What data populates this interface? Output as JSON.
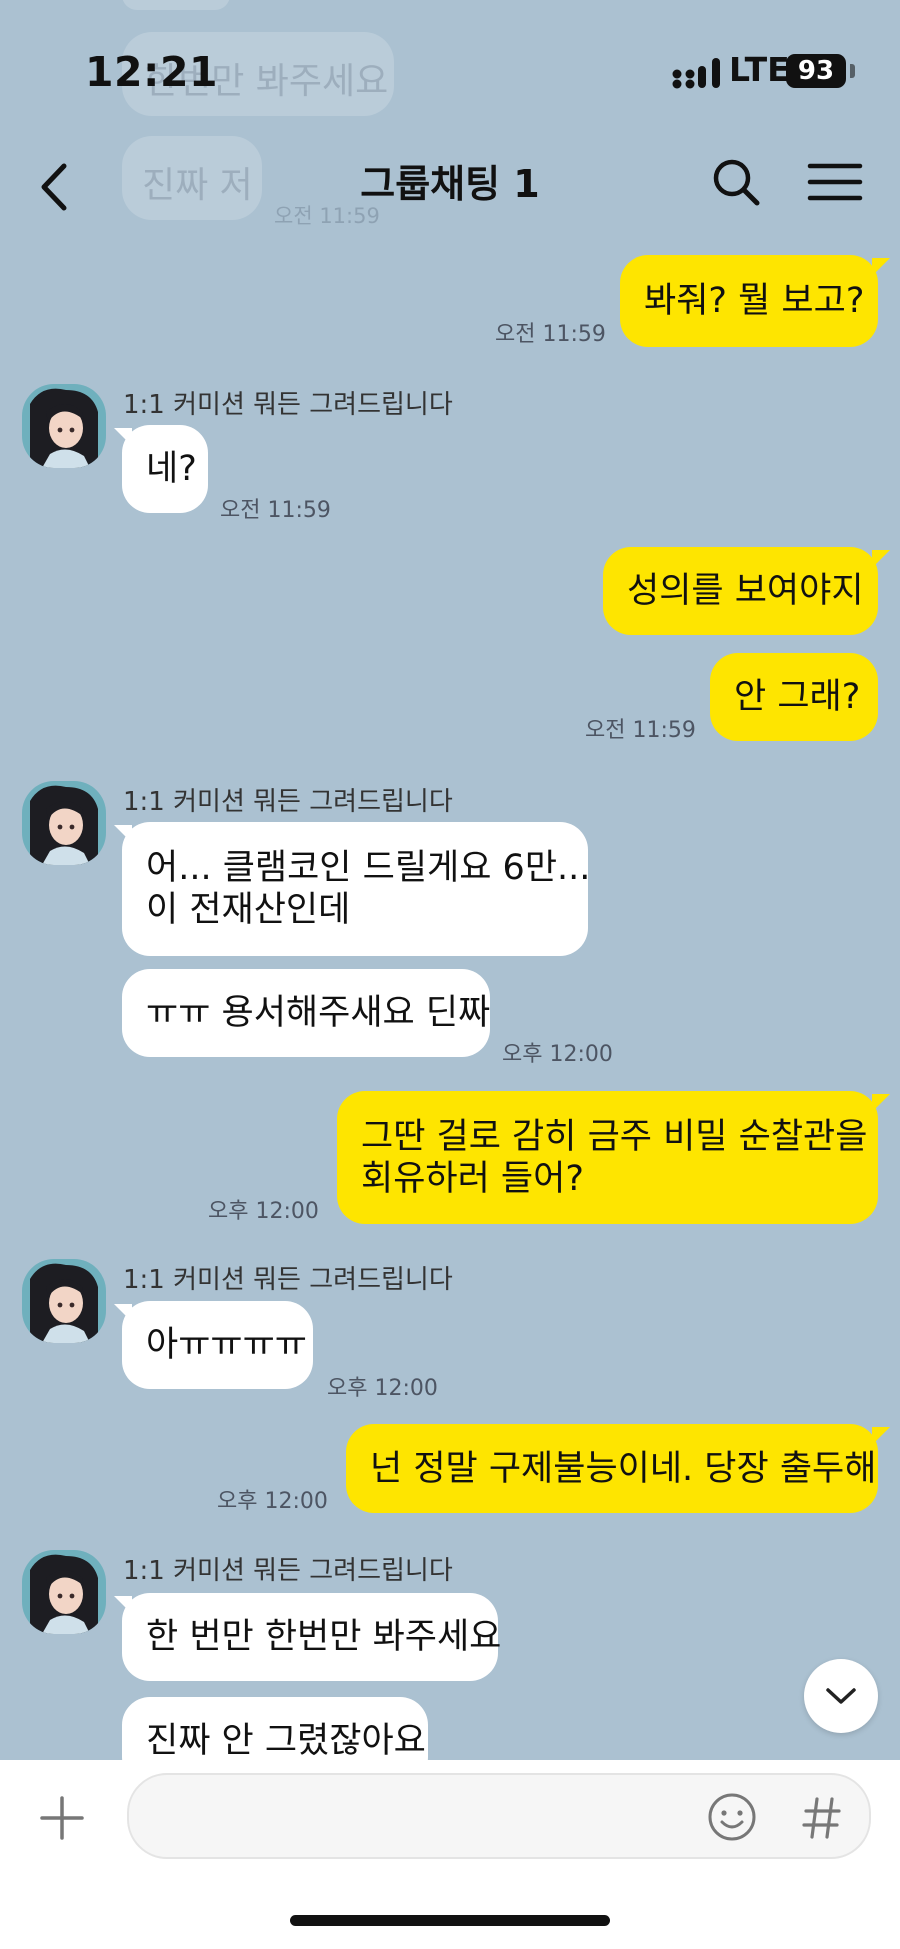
{
  "status_bar": {
    "time": "12:21",
    "network": "LTE",
    "battery": "93"
  },
  "header": {
    "title": "그룹채팅 1"
  },
  "ghost": {
    "msg1": "한번만 봐주세요",
    "msg2": "진짜 저",
    "time": "오전 11:59"
  },
  "colors": {
    "background": "#abc1d1",
    "my_bubble": "#fee500",
    "their_bubble": "#ffffff"
  },
  "messages": [
    {
      "side": "me",
      "text": "봐줘? 뭘 보고?",
      "time": "오전 11:59"
    },
    {
      "side": "them",
      "sender": "1:1 커미션 뭐든 그려드립니다",
      "text": "네?",
      "time": "오전 11:59"
    },
    {
      "side": "me",
      "text": "성의를 보여야지"
    },
    {
      "side": "me",
      "text": "안 그래?",
      "time": "오전 11:59"
    },
    {
      "side": "them",
      "sender": "1:1 커미션 뭐든 그려드립니다",
      "text_line1": "어... 클램코인 드릴게요 6만...",
      "text_line2": "이 전재산인데"
    },
    {
      "side": "them",
      "text": "ㅠㅠ 용서해주새요 딘짜",
      "time": "오후 12:00"
    },
    {
      "side": "me",
      "text_line1": "그딴 걸로 감히 금주 비밀 순찰관을",
      "text_line2": "회유하러 들어?",
      "time": "오후 12:00"
    },
    {
      "side": "them",
      "sender": "1:1 커미션 뭐든 그려드립니다",
      "text": "아ㅠㅠㅠㅠ",
      "time": "오후 12:00"
    },
    {
      "side": "me",
      "text": "넌 정말 구제불능이네. 당장 출두해",
      "time": "오후 12:00"
    },
    {
      "side": "them",
      "sender": "1:1 커미션 뭐든 그려드립니다",
      "text": "한 번만 한번만 봐주세요"
    },
    {
      "side": "them",
      "text": "진짜 안 그렸잖아요"
    }
  ],
  "composer": {
    "placeholder": "",
    "hash": "#"
  },
  "icons": [
    "back-arrow-icon",
    "search-icon",
    "menu-icon",
    "chevron-down-icon",
    "plus-icon",
    "emoji-icon",
    "hash-icon",
    "signal-icon"
  ]
}
